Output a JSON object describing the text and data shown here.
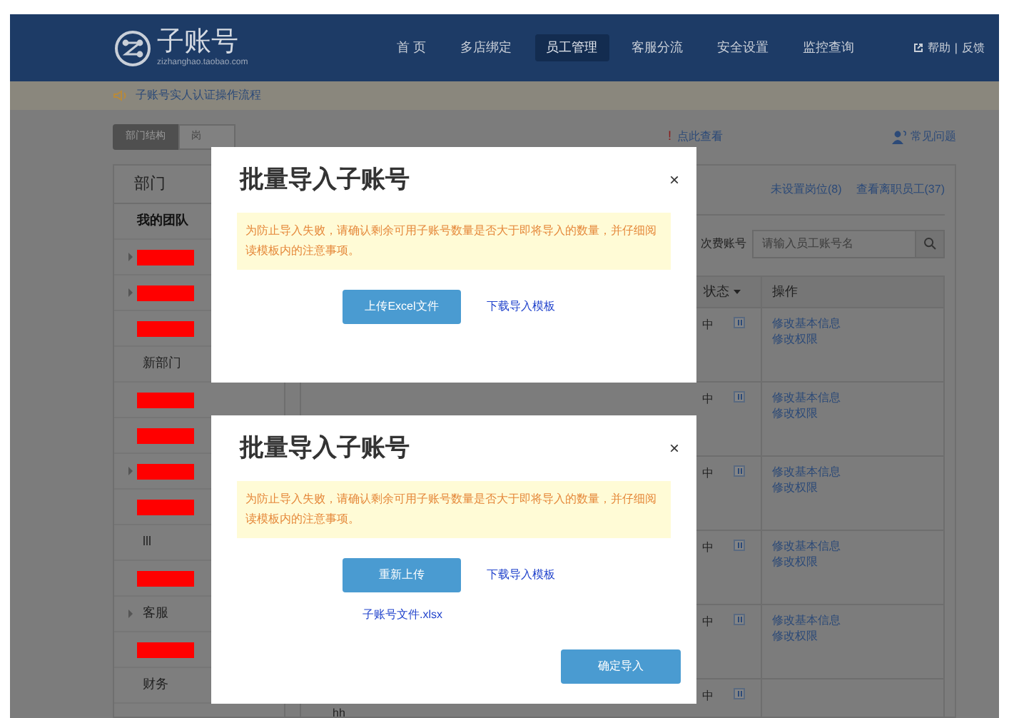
{
  "header": {
    "logo_text": "子账号",
    "logo_url": "zizhanghao.taobao.com",
    "nav": [
      {
        "label": "首 页",
        "selected": false
      },
      {
        "label": "多店绑定",
        "selected": false
      },
      {
        "label": "员工管理",
        "selected": true
      },
      {
        "label": "客服分流",
        "selected": false
      },
      {
        "label": "安全设置",
        "selected": false
      },
      {
        "label": "监控查询",
        "selected": false
      }
    ],
    "help": "帮助",
    "separator": "|",
    "feedback": "反馈"
  },
  "notice": "子账号实人认证操作流程",
  "page": {
    "tabs": [
      {
        "label": "部门结构",
        "selected": true
      },
      {
        "label": "岗",
        "selected": false
      }
    ],
    "alert_mark": "!",
    "alert_link": "点此查看",
    "faq": "常见问题",
    "sidebar": {
      "title": "部门",
      "items": [
        {
          "kind": "root",
          "label": "我的团队",
          "expandable": false
        },
        {
          "kind": "redacted",
          "expandable": true
        },
        {
          "kind": "redacted",
          "expandable": true
        },
        {
          "kind": "redacted",
          "expandable": false
        },
        {
          "kind": "text",
          "label": "新部门",
          "expandable": false
        },
        {
          "kind": "redacted",
          "expandable": false
        },
        {
          "kind": "redacted",
          "expandable": false
        },
        {
          "kind": "redacted",
          "expandable": true
        },
        {
          "kind": "redacted",
          "expandable": false
        },
        {
          "kind": "text",
          "label": "lll",
          "expandable": false
        },
        {
          "kind": "redacted",
          "expandable": false
        },
        {
          "kind": "text",
          "label": "客服",
          "expandable": true
        },
        {
          "kind": "redacted",
          "expandable": false
        },
        {
          "kind": "text",
          "label": "财务",
          "expandable": false
        }
      ]
    },
    "links": [
      "未设置岗位(8)",
      "查看离职员工(37)"
    ],
    "search": {
      "label": "次费账号",
      "placeholder": "请输入员工账号名"
    },
    "table": {
      "columns": [
        "状态",
        "操作"
      ],
      "rows": [
        {
          "status": "中",
          "actions": [
            "修改基本信息",
            "修改权限"
          ]
        },
        {
          "status": "中",
          "actions": [
            "修改基本信息",
            "修改权限"
          ]
        },
        {
          "status": "中",
          "actions": [
            "修改基本信息",
            "修改权限"
          ]
        },
        {
          "status": "中",
          "actions": [
            "修改基本信息",
            "修改权限"
          ]
        },
        {
          "status": "中",
          "actions": [
            "修改基本信息",
            "修改权限"
          ]
        },
        {
          "name": "hh",
          "status": "中"
        }
      ]
    }
  },
  "dialogs": [
    {
      "title": "批量导入子账号",
      "close": "×",
      "warning": "为防止导入失败，请确认剩余可用子账号数量是否大于即将导入的数量，并仔细阅读模板内的注意事项。",
      "upload_button": "上传Excel文件",
      "template_link": "下载导入模板"
    },
    {
      "title": "批量导入子账号",
      "close": "×",
      "warning": "为防止导入失败，请确认剩余可用子账号数量是否大于即将导入的数量，并仔细阅读模板内的注意事项。",
      "upload_button": "重新上传",
      "template_link": "下载导入模板",
      "file_link": "子账号文件.xlsx",
      "confirm_button": "确定导入"
    }
  ]
}
